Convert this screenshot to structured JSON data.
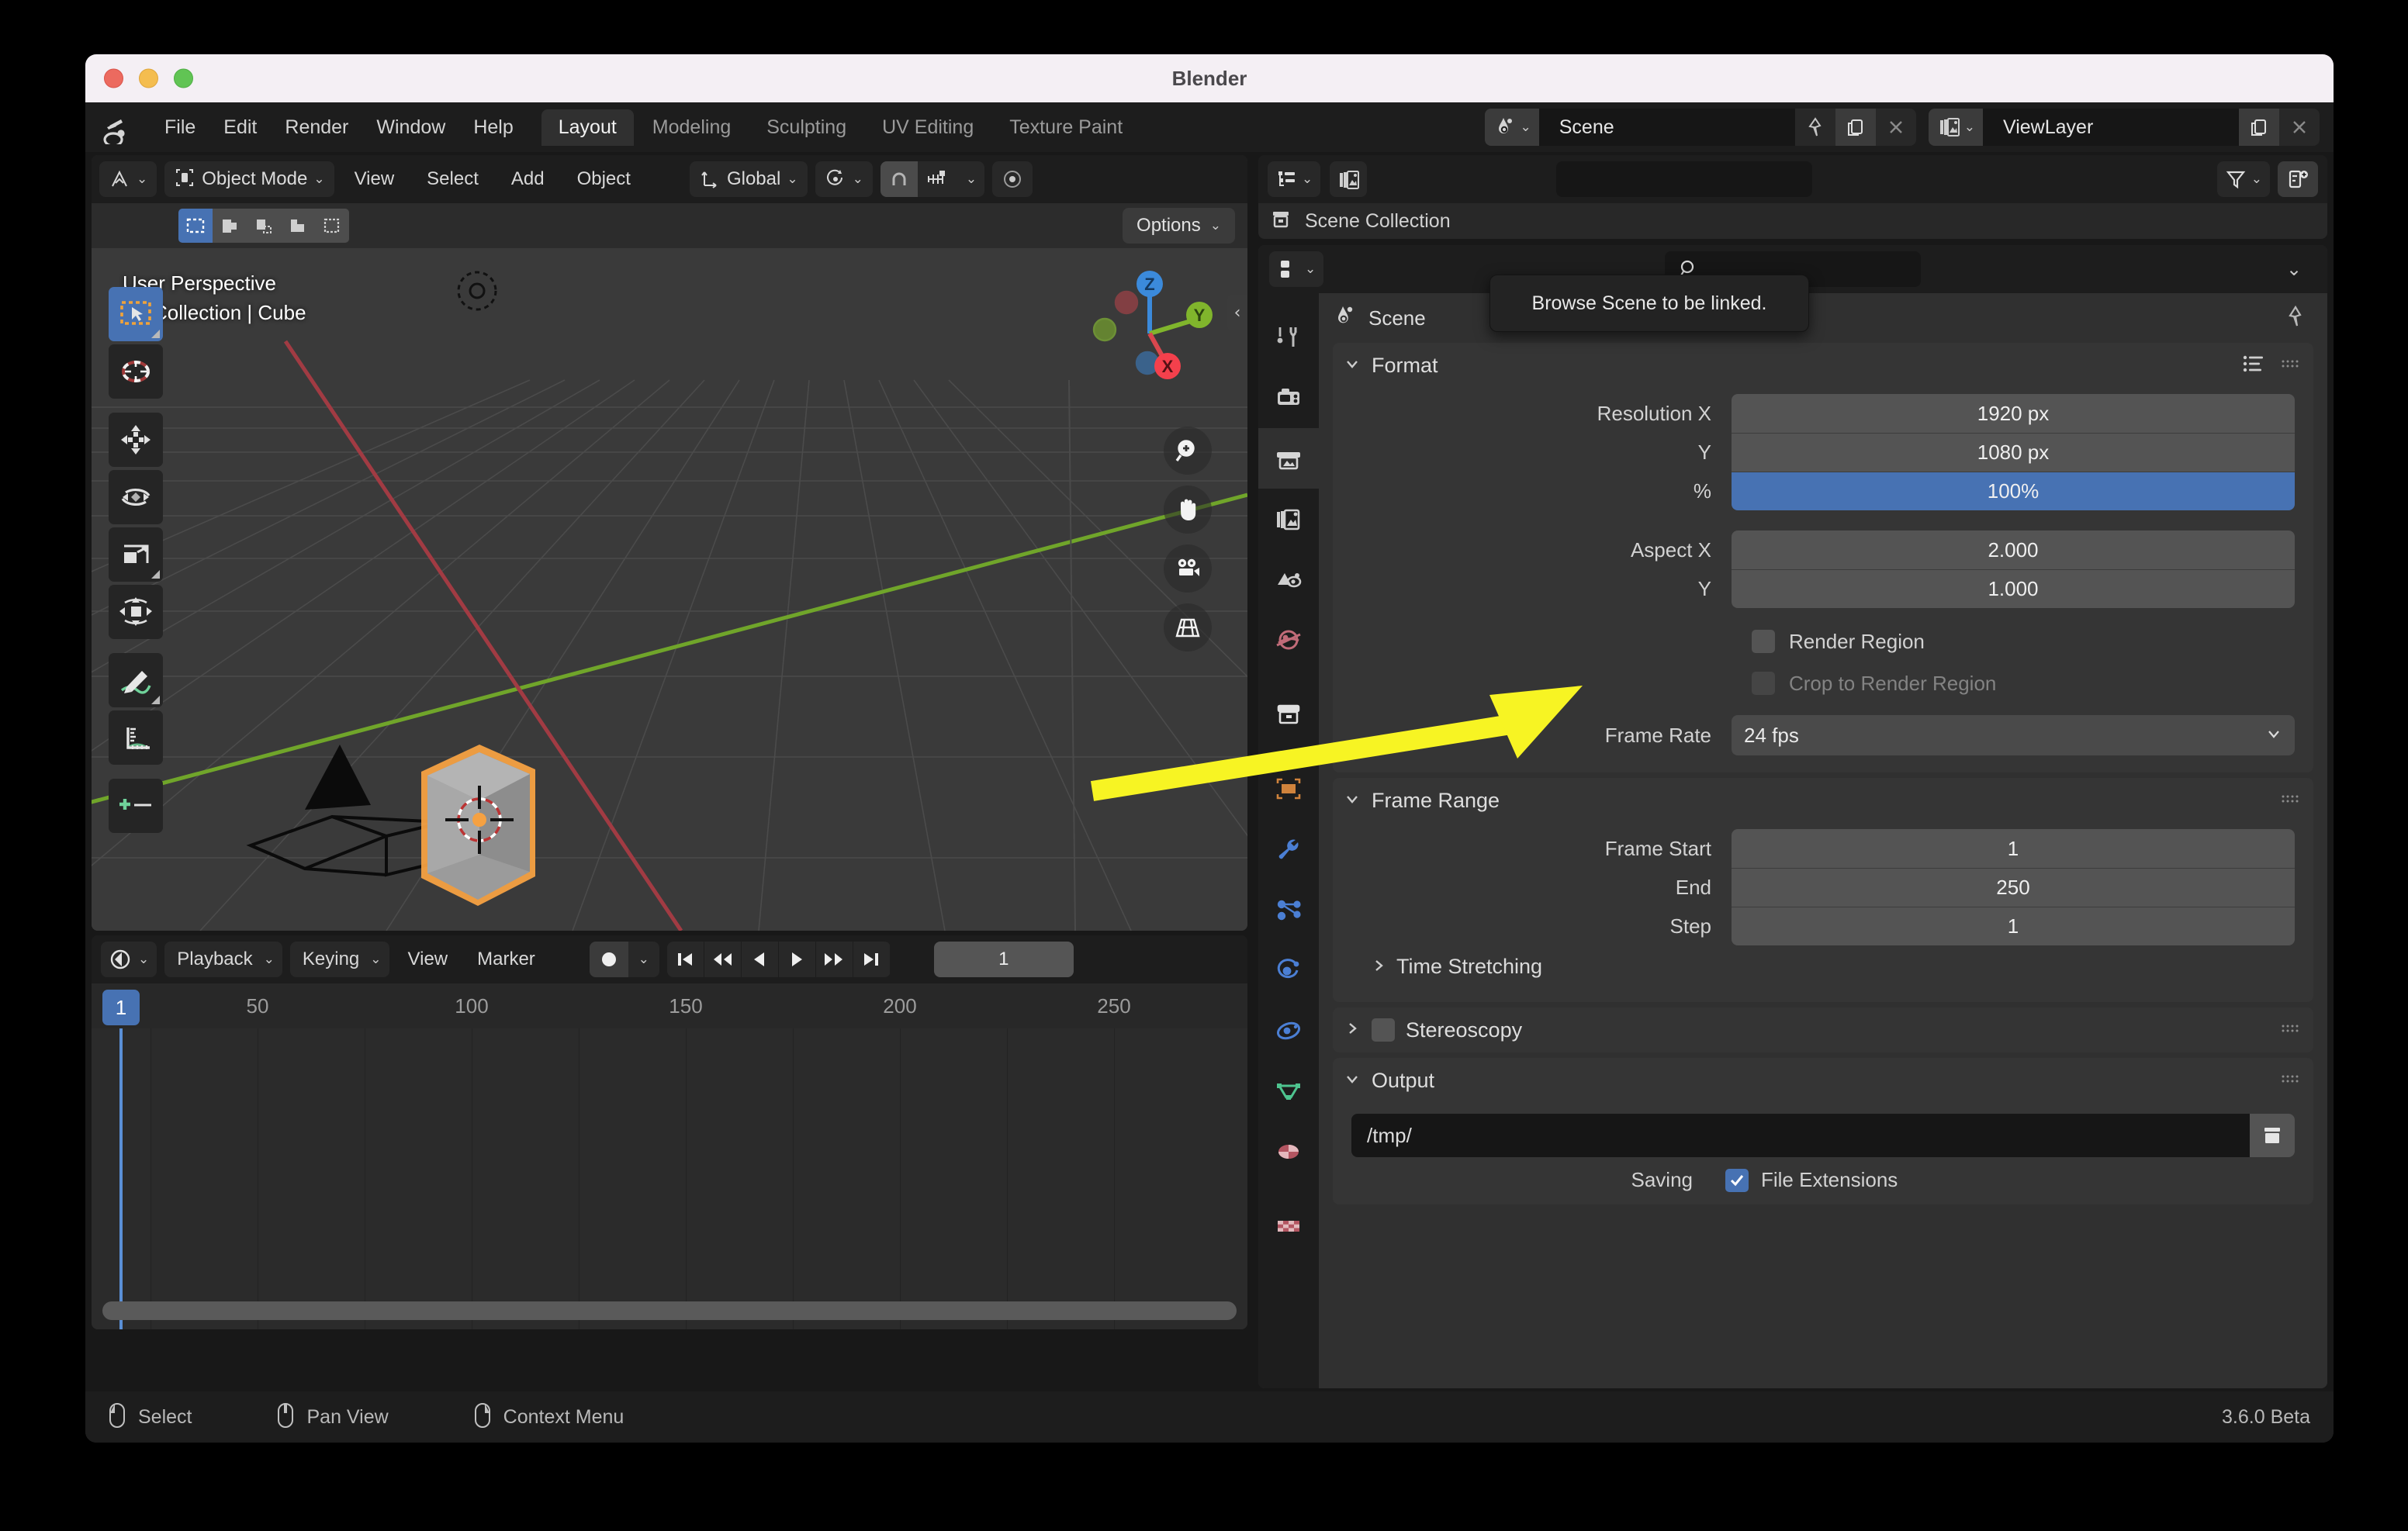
{
  "window": {
    "title": "Blender"
  },
  "topbar": {
    "logo_icon": "blender-logo-icon",
    "menus": [
      "File",
      "Edit",
      "Render",
      "Window",
      "Help"
    ],
    "workspace_tabs": [
      {
        "label": "Layout",
        "active": true
      },
      {
        "label": "Modeling",
        "active": false
      },
      {
        "label": "Sculpting",
        "active": false
      },
      {
        "label": "UV Editing",
        "active": false
      },
      {
        "label": "Texture Paint",
        "active": false
      }
    ],
    "scene_selector": {
      "icon": "scene-data-icon",
      "name": "Scene",
      "pin_icon": "pin-icon",
      "copy_icon": "new-scene-icon",
      "close_icon": "x-icon"
    },
    "viewlayer_selector": {
      "icon": "viewlayer-icon",
      "name": "ViewLayer",
      "copy_icon": "new-viewlayer-icon",
      "close_icon": "x-icon"
    }
  },
  "tooltip": {
    "text": "Browse Scene to be linked."
  },
  "viewport": {
    "header": {
      "editor_type_icon": "editor-type-3dview-icon",
      "mode": "Object Mode",
      "mode_icon": "object-mode-icon",
      "menus": [
        "View",
        "Select",
        "Add",
        "Object"
      ],
      "transform_orientation": "Global",
      "transform_orientation_icon": "orientation-icon",
      "pivot_icon": "pivot-point-icon",
      "snap_icon": "magnet-icon",
      "snap_target_icon": "snap-increment-icon",
      "proportional_icon": "proportional-editing-icon"
    },
    "subheader": {
      "select_modes": [
        "set",
        "extend",
        "subtract",
        "invert",
        "intersect"
      ],
      "options_label": "Options"
    },
    "overlay_line1": "User Perspective",
    "overlay_line2": "(1) Collection | Cube",
    "gizmo_axes": [
      "X",
      "Y",
      "Z"
    ],
    "nav_buttons": [
      "zoom-icon",
      "pan-hand-icon",
      "camera-view-icon",
      "perspective-toggle-icon"
    ],
    "toolbar_tools": [
      "tweak-select-box-icon",
      "cursor-icon",
      "move-icon",
      "rotate-icon",
      "scale-icon",
      "transform-icon",
      "annotate-icon",
      "measure-icon",
      "add-cube-icon"
    ]
  },
  "timeline": {
    "header": {
      "editor_type_icon": "editor-type-timeline-icon",
      "menus": [
        "Playback",
        "Keying",
        "View",
        "Marker"
      ],
      "record_icon": "auto-keying-icon",
      "transport": [
        "jump-start-icon",
        "prev-keyframe-icon",
        "play-reverse-icon",
        "play-icon",
        "next-keyframe-icon",
        "jump-end-icon"
      ],
      "current_frame": "1"
    },
    "ruler_ticks": [
      "1",
      "50",
      "100",
      "150",
      "200",
      "250"
    ],
    "playhead_frame": "1"
  },
  "outliner": {
    "editor_type_icon": "editor-type-outliner-icon",
    "display_mode_icon": "outliner-display-mode-icon",
    "search_placeholder": "",
    "filter_icon": "filter-funnel-icon",
    "new_collection_icon": "new-collection-icon",
    "rows": [
      {
        "icon": "scene-collection-icon",
        "label": "Scene Collection"
      }
    ]
  },
  "properties": {
    "editor_type_icon": "editor-type-properties-icon",
    "search_icon": "search-icon",
    "search_value": "",
    "options_chevron": "chevron-down-icon",
    "breadcrumb": {
      "icon": "scene-properties-icon",
      "label": "Scene"
    },
    "pin_icon": "pin-icon",
    "tabs": [
      {
        "name": "tool",
        "icon": "tool-icon",
        "active": false
      },
      {
        "name": "render",
        "icon": "render-camera-icon",
        "active": false
      },
      {
        "name": "output",
        "icon": "output-printer-icon",
        "active": true
      },
      {
        "name": "view-layer",
        "icon": "view-layer-images-icon",
        "active": false
      },
      {
        "name": "scene",
        "icon": "scene-cone-icon",
        "active": false
      },
      {
        "name": "world",
        "icon": "world-globe-icon",
        "active": false
      },
      {
        "name": "collection",
        "icon": "collection-box-icon",
        "active": false
      },
      {
        "name": "object",
        "icon": "object-square-icon",
        "active": false
      },
      {
        "name": "modifiers",
        "icon": "wrench-icon",
        "active": false
      },
      {
        "name": "particles",
        "icon": "particles-icon",
        "active": false
      },
      {
        "name": "physics",
        "icon": "physics-orbit-icon",
        "active": false
      },
      {
        "name": "constraints",
        "icon": "constraints-icon",
        "active": false
      },
      {
        "name": "data",
        "icon": "mesh-data-triangle-icon",
        "active": false
      },
      {
        "name": "material",
        "icon": "material-sphere-icon",
        "active": false
      },
      {
        "name": "texture",
        "icon": "texture-checker-icon",
        "active": false
      }
    ],
    "panels": {
      "format": {
        "title": "Format",
        "collapse_icon": "chevron-down-icon",
        "list_icon": "preset-list-icon",
        "grip_icon": "grip-dots-icon",
        "fields": [
          {
            "label": "Resolution X",
            "value": "1920 px",
            "highlight": false
          },
          {
            "label": "Y",
            "value": "1080 px",
            "highlight": false
          },
          {
            "label": "%",
            "value": "100%",
            "highlight": true
          },
          {
            "label": "Aspect X",
            "value": "2.000",
            "highlight": false
          },
          {
            "label": "Y",
            "value": "1.000",
            "highlight": false
          }
        ],
        "checkboxes": [
          {
            "label": "Render Region",
            "checked": false,
            "disabled": false
          },
          {
            "label": "Crop to Render Region",
            "checked": false,
            "disabled": true
          }
        ],
        "frame_rate": {
          "label": "Frame Rate",
          "value": "24 fps"
        }
      },
      "frame_range": {
        "title": "Frame Range",
        "collapse_icon": "chevron-down-icon",
        "grip_icon": "grip-dots-icon",
        "fields": [
          {
            "label": "Frame Start",
            "value": "1"
          },
          {
            "label": "End",
            "value": "250"
          },
          {
            "label": "Step",
            "value": "1"
          }
        ],
        "subpanel": {
          "label": "Time Stretching",
          "collapse_icon": "chevron-right-icon"
        }
      },
      "stereoscopy": {
        "title": "Stereoscopy",
        "collapse_icon": "chevron-right-icon",
        "checked": false,
        "grip_icon": "grip-dots-icon"
      },
      "output": {
        "title": "Output",
        "collapse_icon": "chevron-down-icon",
        "grip_icon": "grip-dots-icon",
        "path_value": "/tmp/",
        "folder_icon": "folder-icon",
        "saving_label": "Saving",
        "file_extensions": {
          "label": "File Extensions",
          "checked": true
        }
      }
    }
  },
  "statusbar": {
    "items": [
      {
        "icon": "mouse-left-icon",
        "label": "Select"
      },
      {
        "icon": "mouse-middle-icon",
        "label": "Pan View"
      },
      {
        "icon": "mouse-right-icon",
        "label": "Context Menu"
      }
    ],
    "version": "3.6.0 Beta"
  },
  "colors": {
    "accent_blue": "#4772b3",
    "panel_bg": "#353535",
    "editor_bg": "#303030",
    "header_bg": "#1d1d1d",
    "field_bg": "#545454",
    "annotation_yellow": "#f7f423"
  }
}
